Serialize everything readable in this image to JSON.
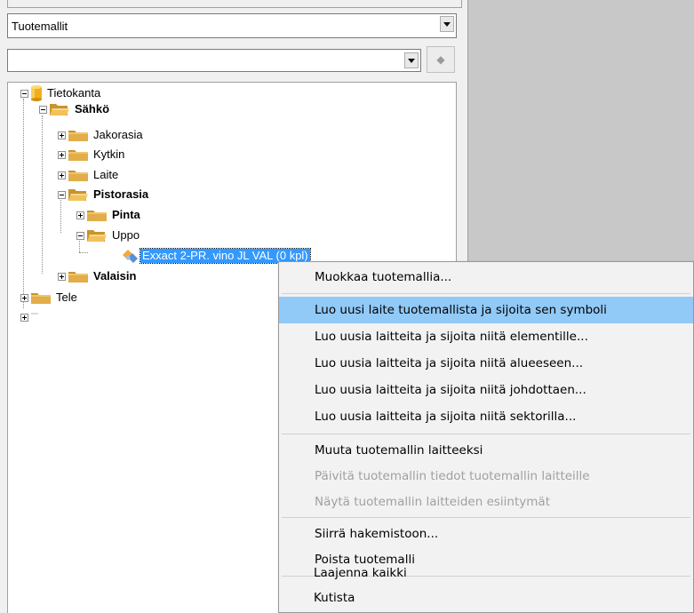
{
  "top_combo": {
    "value": "Tuotemallit"
  },
  "second_combo": {
    "value": ""
  },
  "tree": {
    "root": "Tietokanta",
    "sahko": "Sähkö",
    "jakorasia": "Jakorasia",
    "kytkin": "Kytkin",
    "laite": "Laite",
    "pistorasia": "Pistorasia",
    "pinta": "Pinta",
    "uppo": "Uppo",
    "selected_item": "Exxact 2-PR. vino JL VAL (0 kpl)",
    "valaisin": "Valaisin",
    "tele": "Tele",
    "unnamed": ""
  },
  "context_menu": {
    "items": [
      {
        "label": "Muokkaa tuotemallia...",
        "enabled": true
      },
      {
        "label": "Luo uusi laite tuotemallista ja sijoita sen symboli",
        "enabled": true,
        "highlighted": true
      },
      {
        "label": "Luo uusia laitteita ja sijoita niitä elementille...",
        "enabled": true
      },
      {
        "label": "Luo uusia laitteita ja sijoita niitä alueeseen...",
        "enabled": true
      },
      {
        "label": "Luo uusia laitteita ja sijoita niitä johdottaen...",
        "enabled": true
      },
      {
        "label": "Luo uusia laitteita ja sijoita niitä sektorilla...",
        "enabled": true
      },
      {
        "label": "Muuta tuotemallin laitteeksi",
        "enabled": true
      },
      {
        "label": "Päivitä tuotemallin tiedot tuotemallin laitteille",
        "enabled": false
      },
      {
        "label": "Näytä tuotemallin laitteiden esiintymät",
        "enabled": false
      },
      {
        "label": "Siirrä hakemistoon...",
        "enabled": true
      },
      {
        "label": "Poista tuotemalli",
        "enabled": true
      },
      {
        "label": "Laajenna kaikki",
        "enabled": true
      },
      {
        "label": "Kutista",
        "enabled": true
      }
    ]
  },
  "icons": {
    "database": "database-icon",
    "folder_open": "folder-open-icon",
    "folder_closed": "folder-closed-icon",
    "product_model": "product-model-icon",
    "nav_arrow": "arrow-right-icon"
  },
  "colors": {
    "selection": "#3399ff",
    "menu_highlight": "#91c9f7",
    "right_panel": "#c8c8c8",
    "folder": "#e8b04a",
    "database": "#f2b81a"
  }
}
